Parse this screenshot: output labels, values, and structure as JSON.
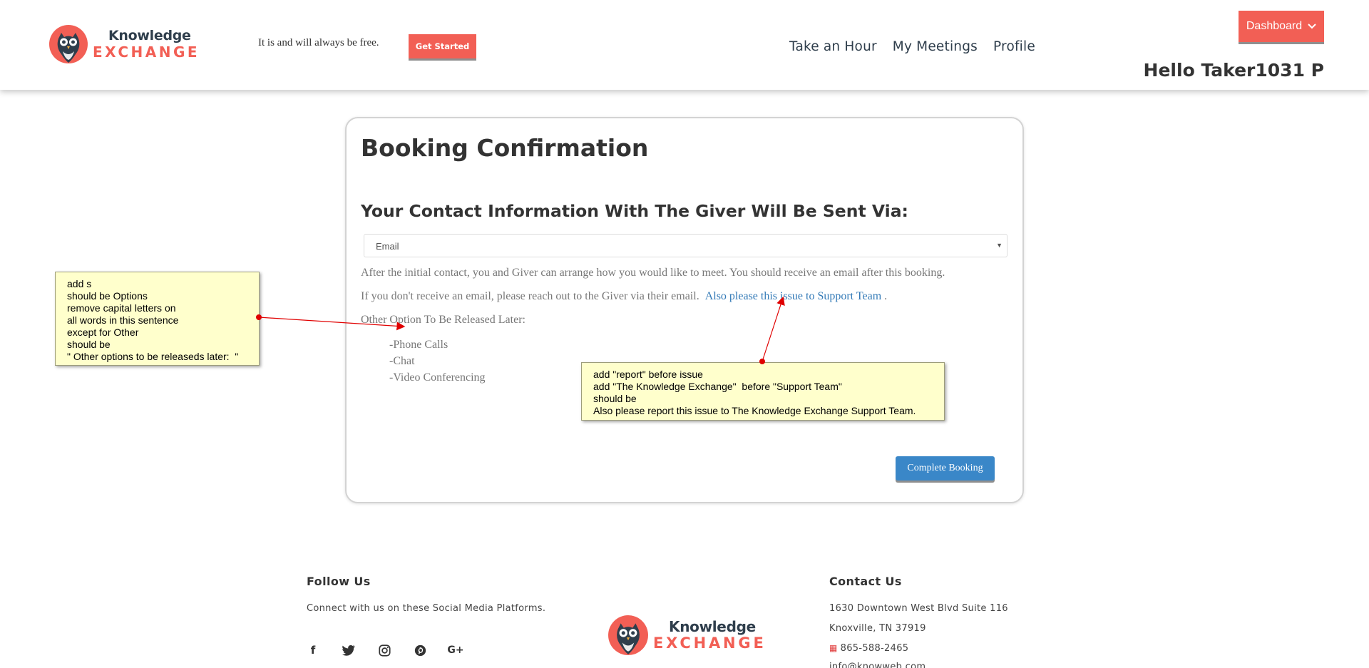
{
  "header": {
    "logo": {
      "line1": "Knowledge",
      "line2": "EXCHANGE"
    },
    "tagline": "It is and will always be free.",
    "get_started": "Get Started",
    "nav": [
      "Take an Hour",
      "My Meetings",
      "Profile"
    ],
    "dashboard": "Dashboard",
    "greeting": "Hello Taker1031 P"
  },
  "card": {
    "title": "Booking Confirmation",
    "subtitle": "Your Contact Information With The Giver Will Be Sent Via:",
    "select_value": "Email",
    "p1": "After the initial contact, you and Giver can arrange how you would like to meet. You should receive an email after this booking.",
    "p2": "If you don't receive an email, please reach out to the Giver via their email.",
    "p2_link": "Also please this issue to Support Team",
    "p2_end": ".",
    "p3": "Other Option To Be Released Later:",
    "options": [
      "-Phone Calls",
      "-Chat",
      "-Video Conferencing"
    ],
    "complete_button": "Complete Booking"
  },
  "annotations": {
    "note1": [
      "add s",
      "should be Options",
      "remove capital letters on",
      "all words in this sentence",
      "except for Other",
      "should be",
      "\" Other options to be releaseds later:  \""
    ],
    "note2": [
      "add \"report\" before issue",
      "add \"The Knowledge Exchange\"  before \"Support Team\"",
      "should be",
      "Also please report this issue to The Knowledge Exchange Support Team."
    ],
    "arrow_color": "#e00000"
  },
  "footer": {
    "follow_title": "Follow Us",
    "follow_text": "Connect with us on these Social Media Platforms.",
    "socials": [
      "facebook-icon",
      "twitter-icon",
      "instagram-icon",
      "pinterest-icon",
      "google-plus-icon"
    ],
    "contact_title": "Contact Us",
    "address1": "1630 Downtown West Blvd Suite 116",
    "address2": "Knoxville, TN 37919",
    "phone": "865-588-2465",
    "email": "info@knowweb.com"
  },
  "colors": {
    "brand": "#f25f55",
    "navy": "#2f3e4c",
    "link": "#337ab7",
    "button_blue": "#3a87c8"
  }
}
